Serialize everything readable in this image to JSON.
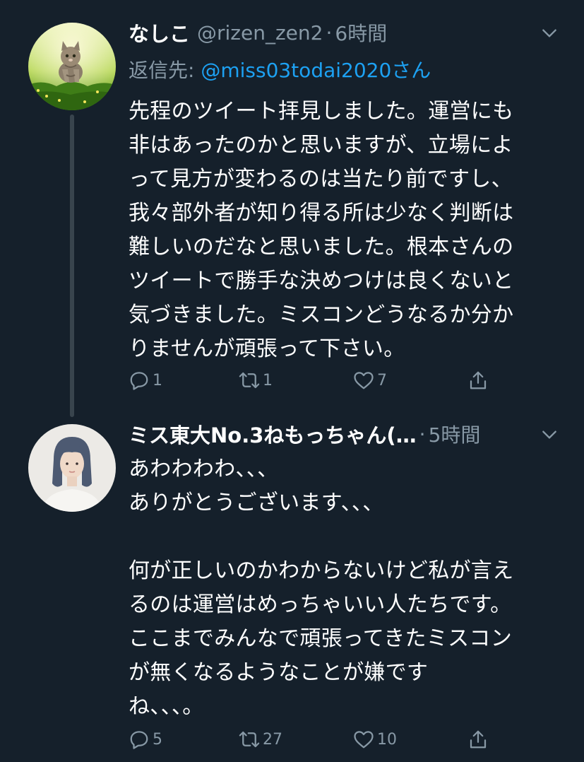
{
  "tweets": [
    {
      "display_name": "なしこ",
      "handle": "@rizen_zen2",
      "separator": "·",
      "time": "6時間",
      "reply_prefix": "返信先: ",
      "reply_mention": "@miss03todai2020さん",
      "text": "先程のツイート拝見しました。運営にも\n非はあったのかと思いますが、立場によ\nって見方が変わるのは当たり前ですし、\n我々部外者が知り得る所は少なく判断は\n難しいのだなと思いました。根本さんの\nツイートで勝手な決めつけは良くないと\n気づきました。ミスコンどうなるか分か\nりませんが頑張って下さい。",
      "reply_count": "1",
      "retweet_count": "1",
      "like_count": "7",
      "avatar_icon": "kitten-photo-avatar"
    },
    {
      "display_name": "ミス東大No.3ねもっちゃん(…",
      "separator": "·",
      "time": "5時間",
      "text": "あわわわわ、、、\nありがとうございます、、、\n\n何が正しいのかわからないけど私が言え\nるのは運営はめっちゃいい人たちです。\nここまでみんなで頑張ってきたミスコン\nが無くなるようなことが嫌です\nね、、、。",
      "reply_count": "5",
      "retweet_count": "27",
      "like_count": "10",
      "avatar_icon": "woman-photo-avatar"
    }
  ],
  "colors": {
    "background": "#15202b",
    "secondary_text": "#8899a6",
    "link": "#1da1f2",
    "thread_line": "#38444d"
  }
}
